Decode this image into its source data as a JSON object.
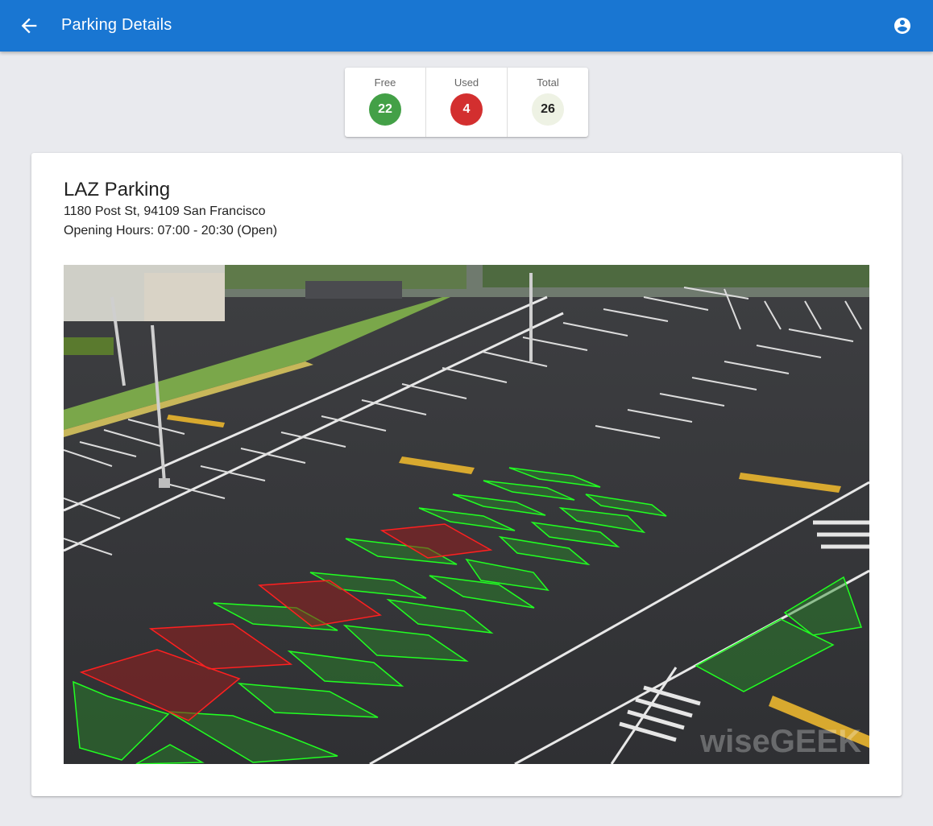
{
  "appbar": {
    "title": "Parking Details",
    "back_icon": "arrow-left-icon",
    "account_icon": "account-circle-icon",
    "color": "#1976d2"
  },
  "stats": {
    "free": {
      "label": "Free",
      "value": "22",
      "color": "#43a047"
    },
    "used": {
      "label": "Used",
      "value": "4",
      "color": "#d32f2f"
    },
    "total": {
      "label": "Total",
      "value": "26",
      "color": "#eef2e4"
    }
  },
  "lot": {
    "name": "LAZ Parking",
    "address": "1180 Post St, 94109 San Francisco",
    "hours": "Opening Hours: 07:00 - 20:30 (Open)",
    "image": {
      "watermark": "wiseGEEK",
      "free_spot_color": "#00ff00",
      "used_spot_color": "#ff1a1a"
    }
  }
}
